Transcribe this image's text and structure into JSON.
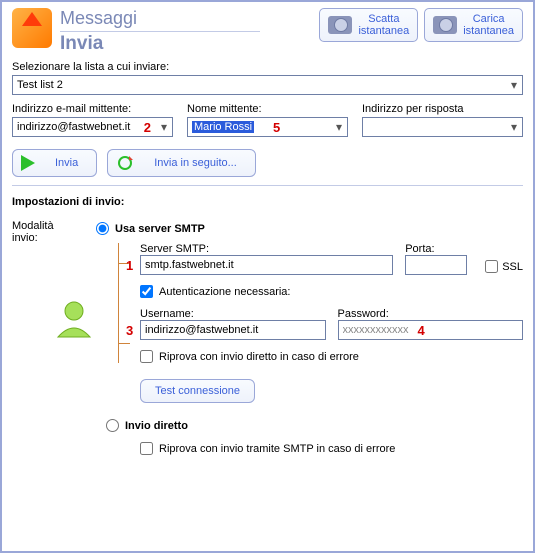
{
  "header": {
    "title": "Messaggi",
    "subtitle": "Invia"
  },
  "snapshot": {
    "take_line1": "Scatta",
    "take_line2": "istantanea",
    "load_line1": "Carica",
    "load_line2": "istantanea"
  },
  "list_section": {
    "label": "Selezionare la lista a cui inviare:",
    "value": "Test list 2"
  },
  "sender": {
    "email_label": "Indirizzo e-mail mittente:",
    "email_value": "indirizzo@fastwebnet.it",
    "name_label": "Nome mittente:",
    "name_value": "Mario Rossi",
    "reply_label": "Indirizzo per risposta",
    "reply_value": ""
  },
  "actions": {
    "send": "Invia",
    "send_later": "Invia in seguito..."
  },
  "settings": {
    "title": "Impostazioni di invio:",
    "mode_label": "Modalità invio:",
    "use_smtp_label": "Usa server SMTP",
    "server_label": "Server SMTP:",
    "server_value": "smtp.fastwebnet.it",
    "port_label": "Porta:",
    "port_value": "",
    "ssl_label": "SSL",
    "auth_label": "Autenticazione necessaria:",
    "username_label": "Username:",
    "username_value": "indirizzo@fastwebnet.it",
    "password_label": "Password:",
    "password_value": "xxxxxxxxxxxx",
    "retry_direct_label": "Riprova con invio diretto in caso di errore",
    "test_conn_label": "Test connessione",
    "direct_label": "Invio diretto",
    "retry_smtp_label": "Riprova con invio tramite SMTP in caso di errore"
  },
  "markers": {
    "m1": "1",
    "m2": "2",
    "m3": "3",
    "m4": "4",
    "m5": "5"
  }
}
